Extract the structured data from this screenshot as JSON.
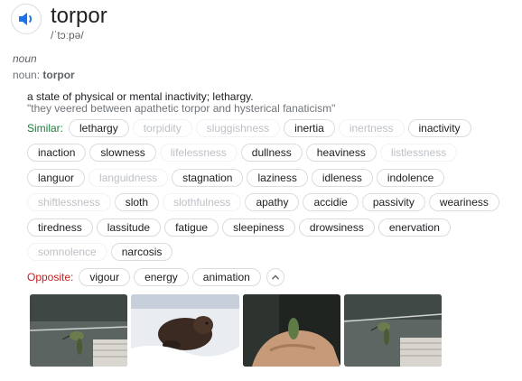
{
  "word": "torpor",
  "phonetic": "/ˈtɔːpə/",
  "pos_italic": "noun",
  "pos_prefix": "noun:",
  "pos_word": "torpor",
  "definition": "a state of physical or mental inactivity; lethargy.",
  "example": "\"they veered between apathetic torpor and hysterical fanaticism\"",
  "similar_label": "Similar:",
  "opposite_label": "Opposite:",
  "similar_rows": [
    [
      {
        "text": "lethargy",
        "faded": false
      },
      {
        "text": "torpidity",
        "faded": true
      },
      {
        "text": "sluggishness",
        "faded": true
      },
      {
        "text": "inertia",
        "faded": false
      },
      {
        "text": "inertness",
        "faded": true
      },
      {
        "text": "inactivity",
        "faded": false
      }
    ],
    [
      {
        "text": "inaction",
        "faded": false
      },
      {
        "text": "slowness",
        "faded": false
      },
      {
        "text": "lifelessness",
        "faded": true
      },
      {
        "text": "dullness",
        "faded": false
      },
      {
        "text": "heaviness",
        "faded": false
      },
      {
        "text": "listlessness",
        "faded": true
      }
    ],
    [
      {
        "text": "languor",
        "faded": false
      },
      {
        "text": "languidness",
        "faded": true
      },
      {
        "text": "stagnation",
        "faded": false
      },
      {
        "text": "laziness",
        "faded": false
      },
      {
        "text": "idleness",
        "faded": false
      },
      {
        "text": "indolence",
        "faded": false
      }
    ],
    [
      {
        "text": "shiftlessness",
        "faded": true
      },
      {
        "text": "sloth",
        "faded": false
      },
      {
        "text": "slothfulness",
        "faded": true
      },
      {
        "text": "apathy",
        "faded": false
      },
      {
        "text": "accidie",
        "faded": false
      },
      {
        "text": "passivity",
        "faded": false
      },
      {
        "text": "weariness",
        "faded": false
      }
    ],
    [
      {
        "text": "tiredness",
        "faded": false
      },
      {
        "text": "lassitude",
        "faded": false
      },
      {
        "text": "fatigue",
        "faded": false
      },
      {
        "text": "sleepiness",
        "faded": false
      },
      {
        "text": "drowsiness",
        "faded": false
      },
      {
        "text": "enervation",
        "faded": false
      }
    ],
    [
      {
        "text": "somnolence",
        "faded": true
      },
      {
        "text": "narcosis",
        "faded": false
      }
    ]
  ],
  "opposites": [
    "vigour",
    "energy",
    "animation"
  ],
  "icons": {
    "speaker": "speaker-icon",
    "collapse": "chevron-up-icon"
  },
  "colors": {
    "speaker": "#1a73e8",
    "similar": "#188038",
    "opposite": "#c5221f"
  },
  "images": [
    {
      "name": "hummingbird-image-1",
      "alt_kind": "hummingbird on wire"
    },
    {
      "name": "animal-in-snow-image",
      "alt_kind": "animal in snow"
    },
    {
      "name": "hummingbird-in-hand-image",
      "alt_kind": "hummingbird in hand"
    },
    {
      "name": "hummingbird-image-2",
      "alt_kind": "hummingbird on wire"
    }
  ]
}
